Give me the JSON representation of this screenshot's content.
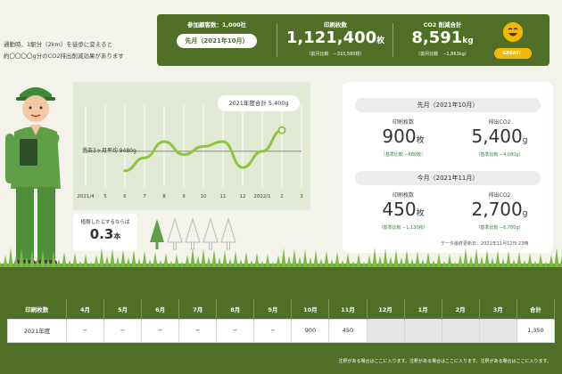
{
  "commute": {
    "line1": "通勤時、1駅分（2km）を徒歩に変えると",
    "line2": "約〇〇〇〇g分のCO2排出削減効果があります"
  },
  "banner": {
    "customers_label": "参加顧客数：1,000社",
    "prev_month_pill": "先月（2021年10月）",
    "prints_label": "印刷枚数",
    "prints_value": "1,121,400",
    "prints_unit": "枚",
    "prints_compare_label": "前月比較",
    "prints_compare_value": "−310,580枚",
    "co2_label": "CO2 削減合計",
    "co2_value": "8,591",
    "co2_unit": "kg",
    "co2_compare_label": "前月比較",
    "co2_compare_value": "−1,863kg",
    "great_label": "GREAT！"
  },
  "chart": {
    "total_label": "2021年度合計 5,400g",
    "avg_label": "過去3ヶ月平均 9480g",
    "x_ticks": [
      "2021/4",
      "5",
      "6",
      "7",
      "8",
      "9",
      "10",
      "11",
      "12",
      "2022/1",
      "2",
      "3"
    ]
  },
  "chart_data": {
    "type": "line",
    "categories": [
      "2021/4",
      "5",
      "6",
      "7",
      "8",
      "9",
      "10",
      "11",
      "12",
      "2022/1",
      "2",
      "3"
    ],
    "values": [
      null,
      null,
      60,
      68,
      78,
      70,
      75,
      78,
      62,
      72,
      85,
      null
    ],
    "avg": 72,
    "ylim": [
      50,
      95
    ],
    "grid": true
  },
  "tree": {
    "question": "植樹したとするならば",
    "value": "0.3",
    "unit": "本"
  },
  "stats": {
    "prev_title": "先月（2021年10月）",
    "curr_title": "今月（2021年11月）",
    "prints_label": "印刷枚数",
    "co2_label": "排出CO2",
    "prev_prints": "900",
    "prev_prints_unit": "枚",
    "prev_prints_sub": "（基準比較 −680枚）",
    "prev_co2": "5,400",
    "prev_co2_unit": "g",
    "prev_co2_sub": "（基準比較 −4,080g）",
    "curr_prints": "450",
    "curr_prints_unit": "枚",
    "curr_prints_sub": "（基準比較 −1,130枚）",
    "curr_co2": "2,700",
    "curr_co2_unit": "g",
    "curr_co2_sub": "（基準比較 −6,780g）",
    "updated": "データ最終更新日：2021年11月12日 23時"
  },
  "table": {
    "headers": [
      "印刷枚数",
      "4月",
      "5月",
      "6月",
      "7月",
      "8月",
      "9月",
      "10月",
      "11月",
      "12月",
      "1月",
      "2月",
      "3月",
      "合計"
    ],
    "row": [
      "2021年度",
      "−",
      "−",
      "−",
      "−",
      "−",
      "−",
      "900",
      "450",
      "",
      "",
      "",
      "",
      "1,350"
    ],
    "note": "注釈がある場合はここに入ります。注釈がある場合はここに入ります。注釈がある場合はここに入ります。"
  },
  "colors": {
    "brand_green": "#4f6f26",
    "line_green": "#8cc63f",
    "accent_yellow": "#f5b800",
    "positive_green": "#2e8b3a"
  }
}
